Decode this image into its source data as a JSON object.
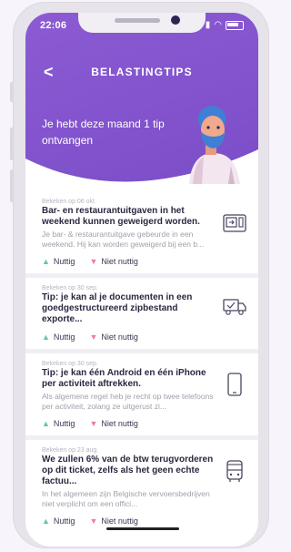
{
  "status_bar": {
    "time": "22:06"
  },
  "header": {
    "back_label": "<",
    "title": "BELASTINGTIPS",
    "promo_text": "Je hebt deze maand 1 tip ontvangen"
  },
  "tips": [
    {
      "date": "Bekeken op 06 okt.",
      "title": "Bar- en restaurantuitgaven in het weekend kunnen geweigerd worden.",
      "description": "Je bar- & restaurantuitgave gebeurde in een weekend. Hij kan worden geweigerd bij een b...",
      "icon": "receipt-machine-icon"
    },
    {
      "date": "Bekeken op 30 sep.",
      "title": "Tip: je kan al je documenten in een goedgestructureerd zipbestand exporte...",
      "description": "",
      "icon": "delivery-truck-icon"
    },
    {
      "date": "Bekeken op 30 sep.",
      "title": "Tip: je kan één Android en één iPhone per activiteit aftrekken.",
      "description": "Als algemene regel heb je recht op twee telefoons per activiteit, zolang ze uitgerust zi...",
      "icon": "smartphone-icon"
    },
    {
      "date": "Bekeken op 23 aug.",
      "title": "We zullen 6% van de btw terugvorderen op dit ticket, zelfs als het geen echte factuu...",
      "description": "In het algemeen zijn Belgische vervoersbedrijven niet verplicht om een offici...",
      "icon": "bus-icon"
    }
  ],
  "feedback": {
    "useful": "Nuttig",
    "not_useful": "Niet nuttig"
  },
  "colors": {
    "header": "#7a4dc8",
    "useful": "#5fc6b0",
    "not_useful": "#ef7ba4"
  }
}
